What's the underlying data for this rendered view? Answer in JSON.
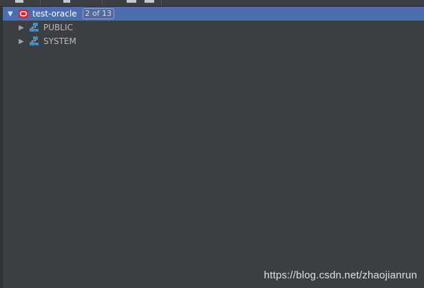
{
  "toolbar": {
    "icons": [
      "toolbar-icon-1",
      "toolbar-icon-2",
      "toolbar-icon-3",
      "toolbar-icon-4"
    ]
  },
  "tree": {
    "root": {
      "label": "test-oracle",
      "badge": "2 of 13",
      "icon": "oracle-icon",
      "expanded": true,
      "selected": true
    },
    "children": [
      {
        "label": "PUBLIC",
        "icon": "schema-icon",
        "expanded": false
      },
      {
        "label": "SYSTEM",
        "icon": "schema-icon",
        "expanded": false
      }
    ]
  },
  "watermark": "https://blog.csdn.net/zhaojianrun",
  "colors": {
    "background": "#3c3f41",
    "selection": "#4b6eaf",
    "oracle_red": "#e61e25",
    "schema_blue": "#3d8ec9",
    "text": "#bbbbbb"
  }
}
